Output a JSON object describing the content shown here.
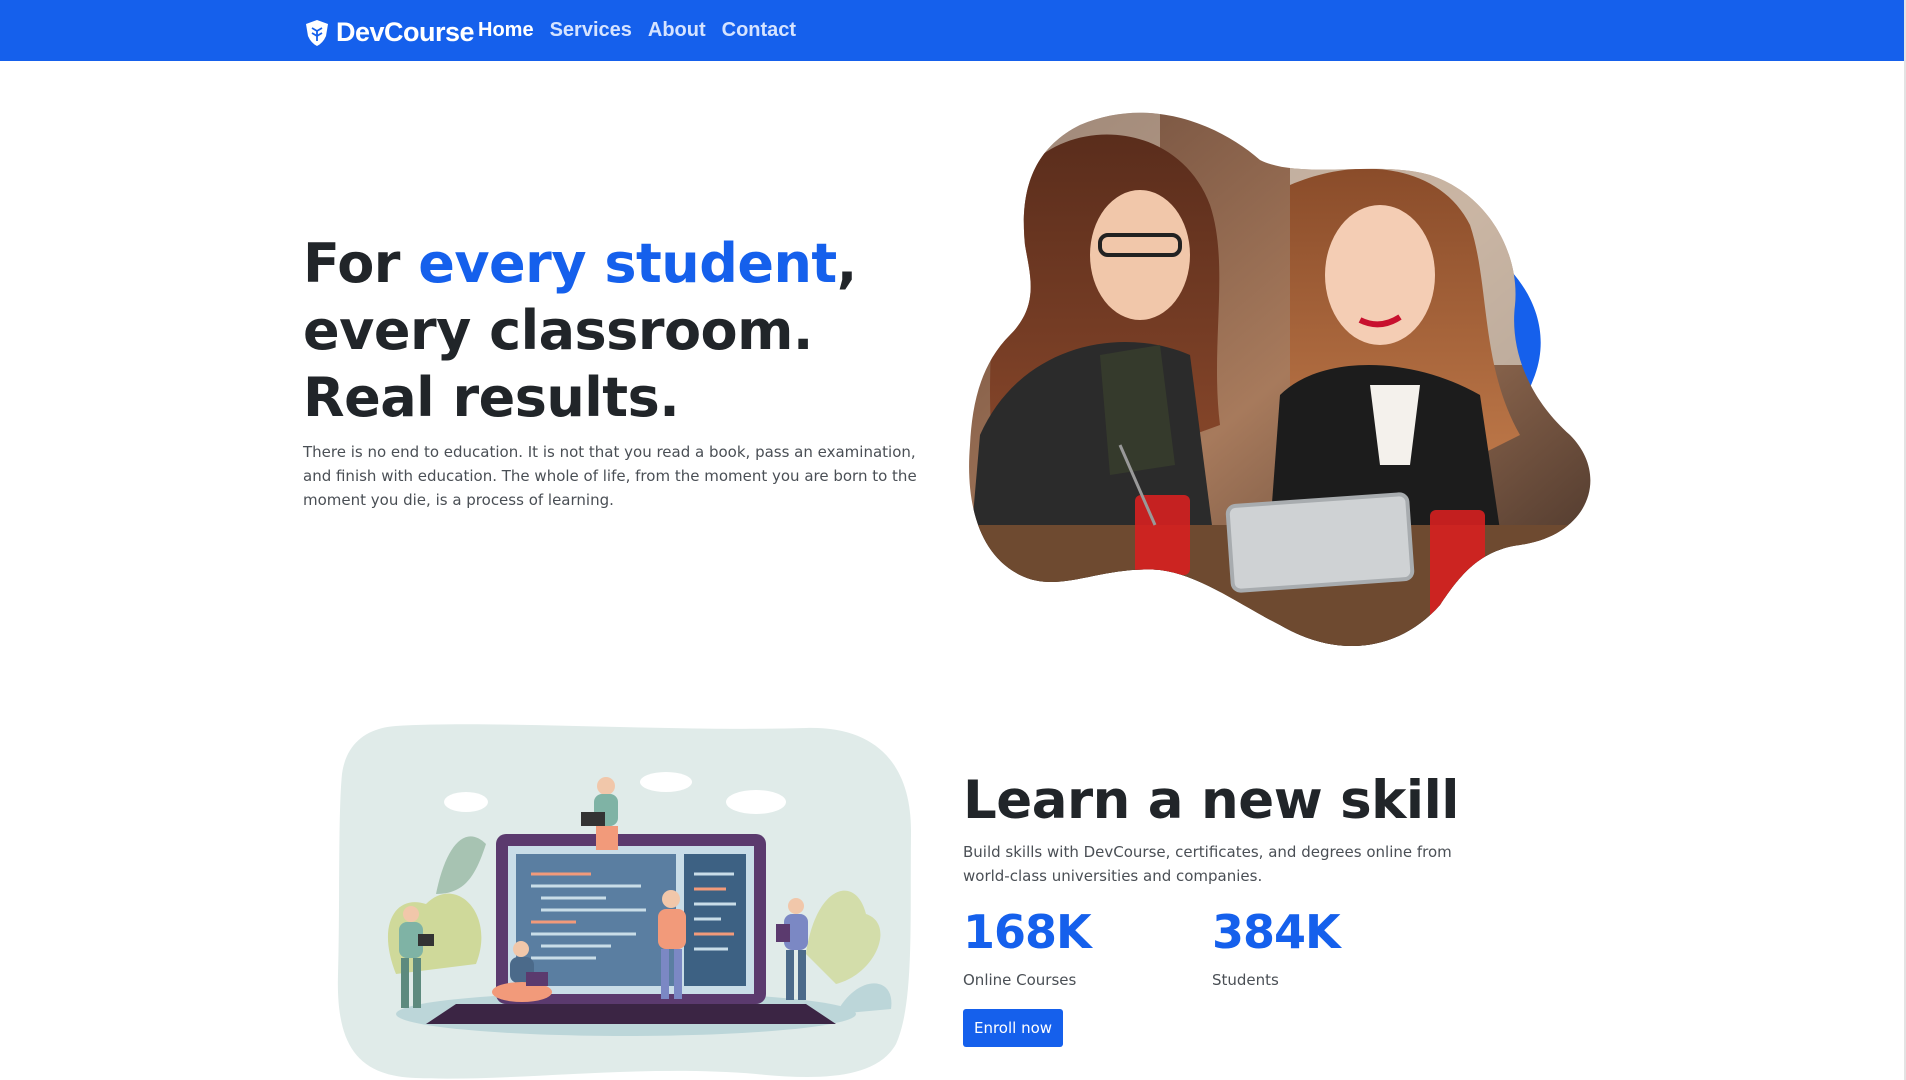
{
  "brand": {
    "name": "DevCourse",
    "icon": "shield-logo-icon"
  },
  "nav": {
    "items": [
      "Home",
      "Services",
      "About",
      "Contact"
    ],
    "active": "Home"
  },
  "hero": {
    "title_part1": "For ",
    "title_accent": "every student",
    "title_part2": ", every classroom. Real results.",
    "description": "There is no end to education. It is not that you read a book, pass an examination, and finish with education. The whole of life, from the moment you are born to the moment you die, is a process of learning."
  },
  "skill": {
    "title": "Learn a new skill",
    "description": "Build skills with DevCourse, certificates, and degrees online from world-class universities and companies.",
    "stats": [
      {
        "value": "168K",
        "label": "Online Courses"
      },
      {
        "value": "384K",
        "label": "Students"
      }
    ],
    "button_label": "Enroll now"
  },
  "colors": {
    "primary": "#1560ec",
    "text": "#212529",
    "muted": "#4a4f55"
  }
}
